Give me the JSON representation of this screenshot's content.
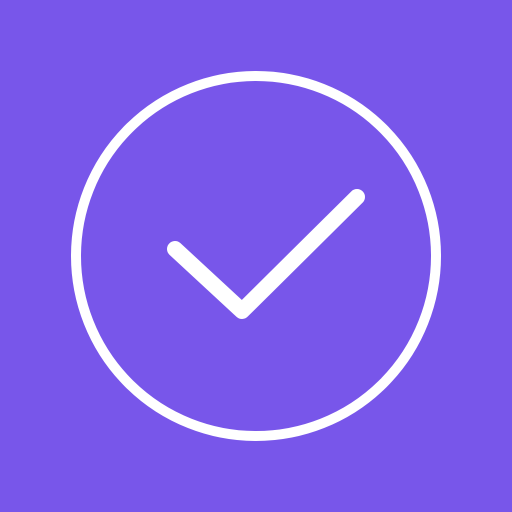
{
  "screen": {
    "background_color": "#7856EA",
    "icon": {
      "name": "check-circle-icon",
      "color": "#FFFFFF"
    }
  }
}
